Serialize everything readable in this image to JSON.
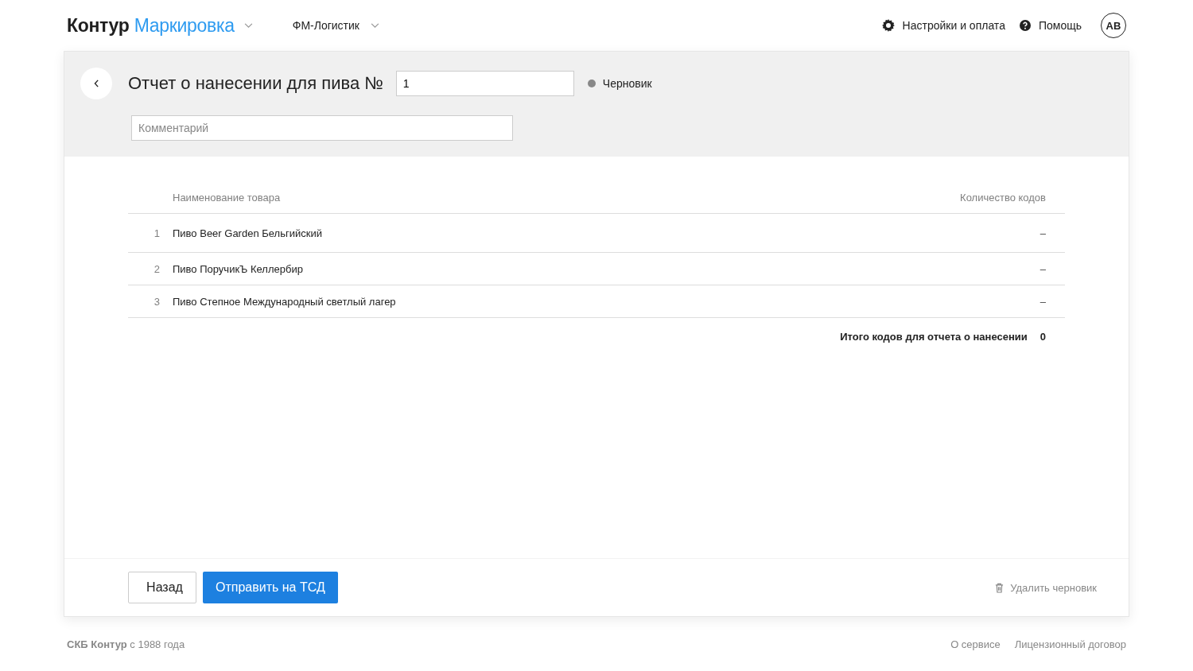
{
  "header": {
    "brand": "Контур",
    "product": "Маркировка",
    "organization": "ФМ-Логистик",
    "settings": "Настройки и оплата",
    "help": "Помощь",
    "avatar": "АВ"
  },
  "document": {
    "title": "Отчет о нанесении для пива №",
    "number": "1",
    "status": "Черновик",
    "comment": {
      "placeholder": "Комментарий"
    }
  },
  "table": {
    "columns": [
      "Наименование товара",
      "Количество кодов"
    ],
    "rows": [
      {
        "index": "1",
        "name": "Пиво Beer Garden Бельгийский",
        "count": "–"
      },
      {
        "index": "2",
        "name": "Пиво ПоручикЪ Келлербир",
        "count": "–"
      },
      {
        "index": "3",
        "name": "Пиво Степное Международный светлый лагер",
        "count": "–"
      }
    ],
    "total": {
      "label": "Итого кодов для отчета о нанесении",
      "value": "0"
    }
  },
  "actions": {
    "back": "Назад",
    "send": "Отправить на ТСД",
    "delete": "Удалить черновик"
  },
  "footer": {
    "copyright": "**СКБ Контур** с 1988 года",
    "links": [
      "О сервисе",
      "Лицензионный договор"
    ]
  }
}
